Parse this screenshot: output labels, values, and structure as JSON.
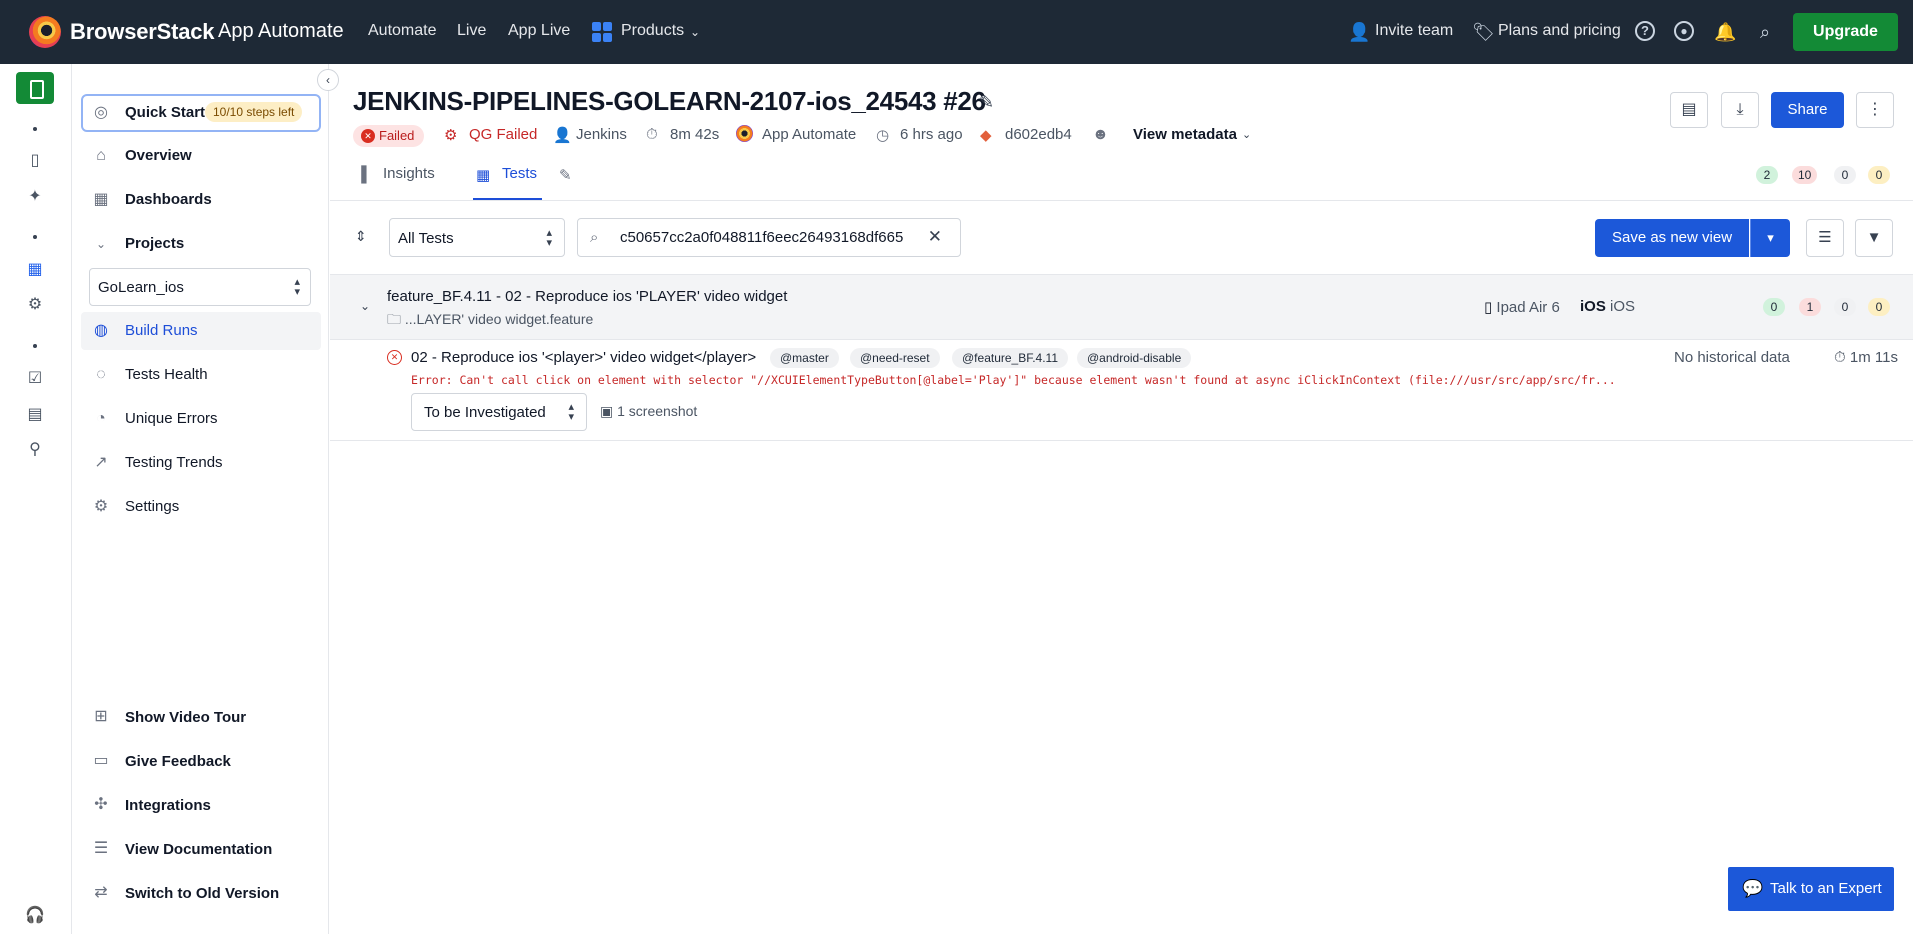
{
  "topnav": {
    "brand": "BrowserStack",
    "product": "App Automate",
    "links": [
      "Automate",
      "Live",
      "App Live"
    ],
    "products_label": "Products",
    "invite": "Invite team",
    "plans": "Plans and pricing",
    "upgrade": "Upgrade"
  },
  "sidebar": {
    "quick_start": "Quick Start",
    "quick_start_badge": "10/10 steps left",
    "overview": "Overview",
    "dashboards": "Dashboards",
    "projects": "Projects",
    "project_selected": "GoLearn_ios",
    "build_runs": "Build Runs",
    "tests_health": "Tests Health",
    "unique_errors": "Unique Errors",
    "testing_trends": "Testing Trends",
    "settings": "Settings",
    "video_tour": "Show Video Tour",
    "feedback": "Give Feedback",
    "integrations": "Integrations",
    "documentation": "View Documentation",
    "old_version": "Switch to Old Version"
  },
  "header": {
    "title": "JENKINS-PIPELINES-GOLEARN-2107-ios_24543 #26",
    "status": "Failed",
    "qg_status": "QG Failed",
    "triggered_by": "Jenkins",
    "duration": "8m 42s",
    "framework": "App Automate",
    "time_ago": "6 hrs ago",
    "commit": "d602edb4",
    "view_metadata": "View metadata",
    "share": "Share"
  },
  "tabs": {
    "insights": "Insights",
    "tests": "Tests"
  },
  "summary_counts": {
    "passed": "2",
    "failed": "10",
    "skipped": "0",
    "other": "0"
  },
  "toolbar": {
    "filter_selected": "All Tests",
    "search_value": "c50657cc2a0f048811f6eec26493168df665",
    "save_view": "Save as new view"
  },
  "group": {
    "title": "feature_BF.4.11 - 02 - Reproduce ios 'PLAYER' video widget",
    "path": "...LAYER' video widget.feature",
    "device": "Ipad Air 6",
    "os_brand": "iOS",
    "os": "iOS",
    "counts": {
      "passed": "0",
      "failed": "1",
      "skipped": "0",
      "other": "0"
    }
  },
  "test": {
    "name": "02 - Reproduce ios '<player>' video widget</player>",
    "tags": [
      "@master",
      "@need-reset",
      "@feature_BF.4.11",
      "@android-disable"
    ],
    "history": "No historical data",
    "duration": "1m 11s",
    "error": "Error: Can't call click on element with selector \"//XCUIElementTypeButton[@label='Play']\" because element wasn't found at async iClickInContext (file:///usr/src/app/src/fr...",
    "status_selected": "To be Investigated",
    "screenshots": "1 screenshot"
  },
  "expert_button": "Talk to an Expert",
  "colors": {
    "nav_bg": "#1e2936",
    "primary": "#1c58d9",
    "upgrade": "#138a36",
    "error": "#c62828"
  }
}
